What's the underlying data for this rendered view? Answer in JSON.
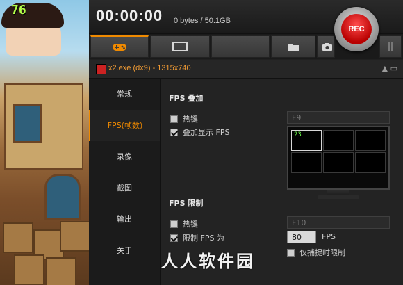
{
  "overlay": {
    "fps_value": "76"
  },
  "top": {
    "timer": "00:00:00",
    "size": "0 bytes / 50.1GB"
  },
  "rec": {
    "label": "REC"
  },
  "tabs": [
    {
      "name": "game-tab",
      "icon": "gamepad-icon"
    },
    {
      "name": "screen-tab",
      "icon": "monitor-icon"
    },
    {
      "name": "blank-tab",
      "icon": ""
    },
    {
      "name": "folder-tab",
      "icon": "folder-icon"
    },
    {
      "name": "camera-tab",
      "icon": "camera-icon"
    }
  ],
  "gamebar": {
    "title": "x2.exe (dx9) - 1315x740",
    "controls": "▲ ▭"
  },
  "sidebar": {
    "items": [
      {
        "label": "常规"
      },
      {
        "label": "FPS(帧数)"
      },
      {
        "label": "录像"
      },
      {
        "label": "截图"
      },
      {
        "label": "输出"
      },
      {
        "label": "关于"
      }
    ]
  },
  "fps_overlay": {
    "heading": "FPS 叠加",
    "hotkey_label": "热键",
    "hotkey_value": "F9",
    "show_label": "叠加显示 FPS",
    "preview_value": "23"
  },
  "fps_limit": {
    "heading": "FPS 限制",
    "hotkey_label": "热键",
    "hotkey_value": "F10",
    "limit_label": "限制 FPS 为",
    "limit_value": "80",
    "unit": "FPS",
    "only_label": "仅捕捉时限制"
  },
  "watermark": "人人软件园",
  "colors": {
    "accent": "#f08a00",
    "rec": "#cc0000",
    "fps_green": "#6cff4a"
  }
}
